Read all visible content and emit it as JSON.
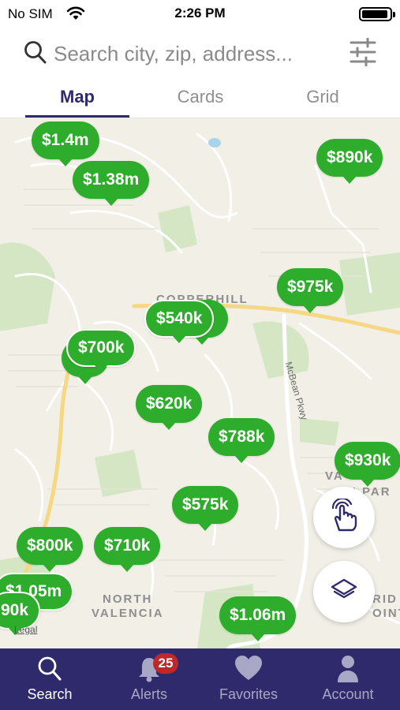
{
  "status_bar": {
    "carrier": "No SIM",
    "time": "2:26 PM"
  },
  "search": {
    "placeholder": "Search city, zip, address..."
  },
  "view_tabs": [
    {
      "label": "Map",
      "active": true
    },
    {
      "label": "Cards",
      "active": false
    },
    {
      "label": "Grid",
      "active": false
    }
  ],
  "map": {
    "area_labels": [
      "COPPERHILL",
      "NORTH",
      "VALENCIA",
      "VA",
      "N PAR",
      "RID",
      "OINT"
    ],
    "road_labels": [
      "McBean Pkwy"
    ],
    "legal": "Legal",
    "pins": [
      "$1.4m",
      "$1.38m",
      "$890k",
      "$975k",
      "$540k",
      "$700k",
      "$620k",
      "$788k",
      "$930k",
      "$575k",
      "$800k",
      "$710k",
      "$1.05m",
      "90k",
      "$1.06m"
    ],
    "buttons": {
      "gesture": "hand-pointer-icon",
      "layers": "layers-icon"
    }
  },
  "tab_bar": [
    {
      "label": "Search",
      "icon": "search-icon",
      "active": true
    },
    {
      "label": "Alerts",
      "icon": "bell-icon",
      "badge": "25",
      "active": false
    },
    {
      "label": "Favorites",
      "icon": "heart-icon",
      "active": false
    },
    {
      "label": "Account",
      "icon": "person-icon",
      "active": false
    }
  ],
  "colors": {
    "brand": "#2e2a6b",
    "pin": "#2dad2b",
    "badge": "#c0272d",
    "map_bg": "#f1efe6"
  }
}
